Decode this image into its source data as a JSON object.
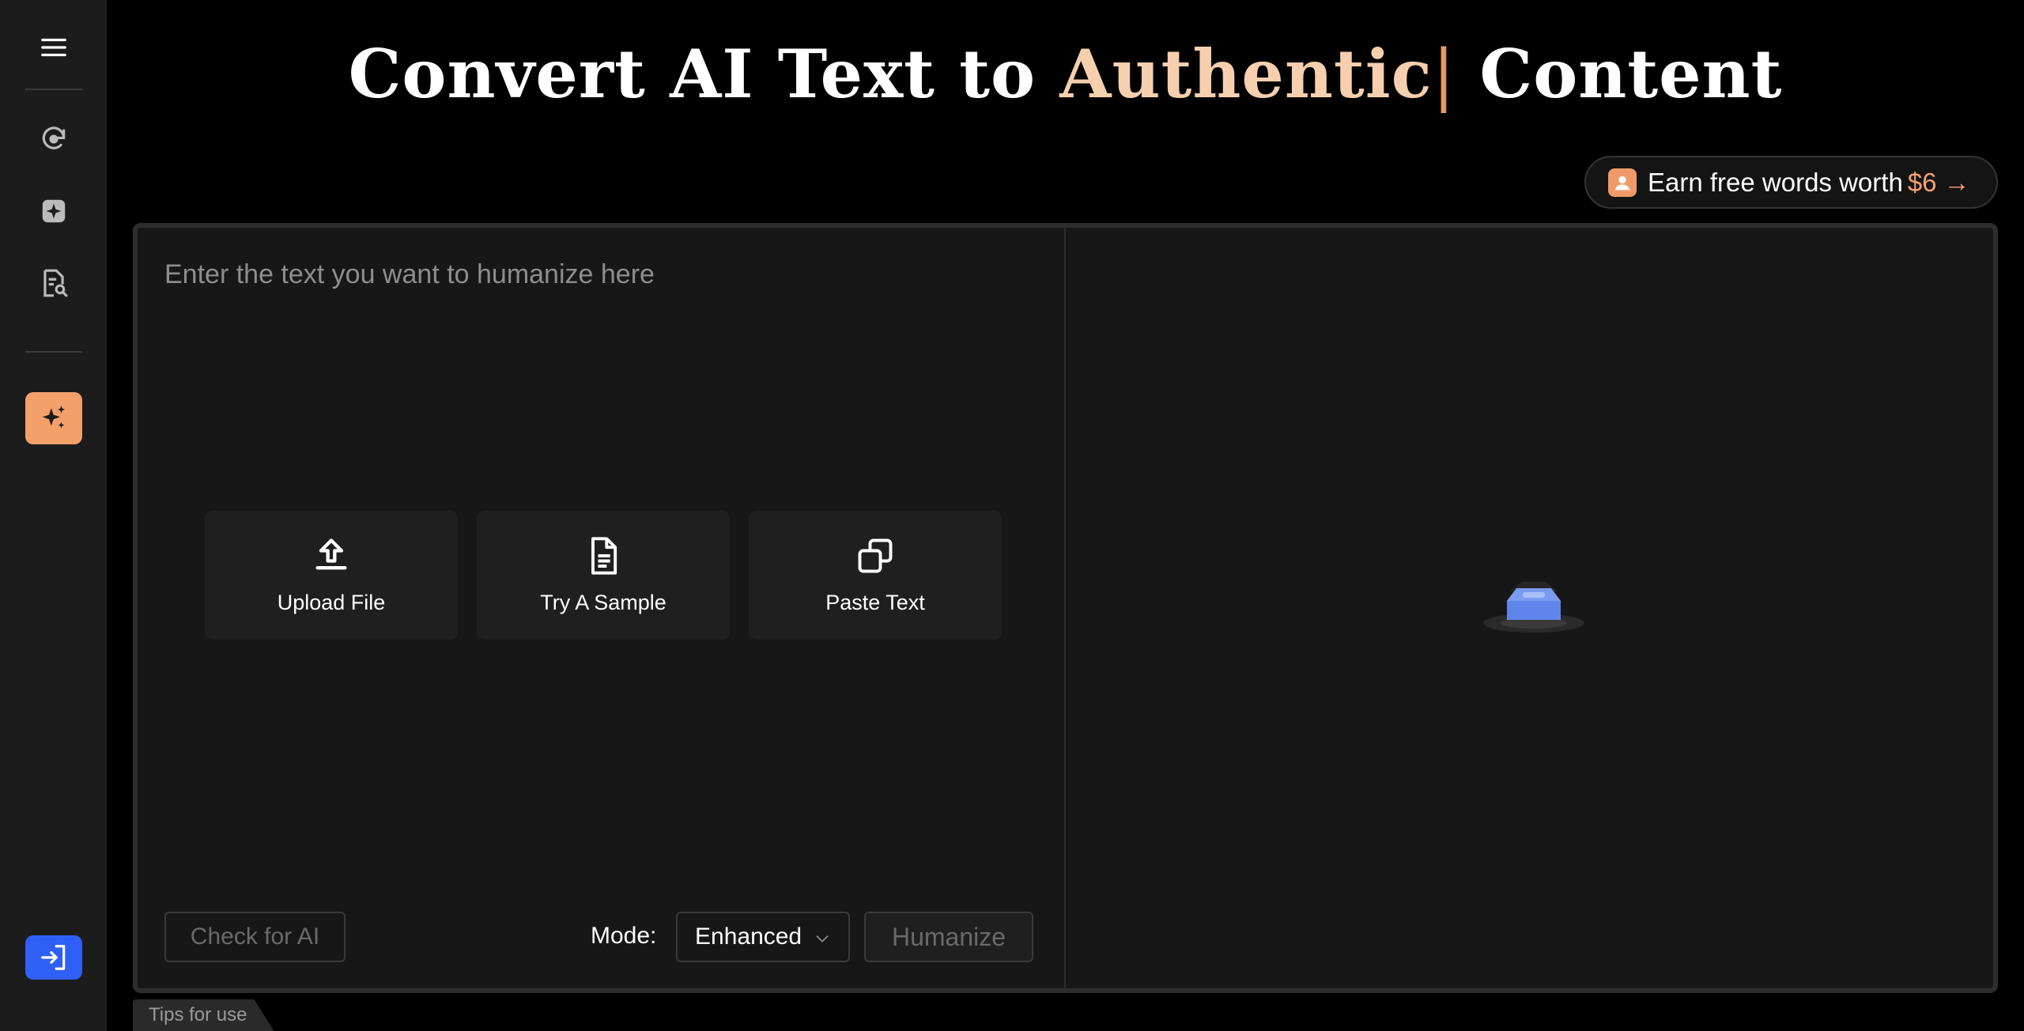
{
  "header": {
    "title_part1": "Convert AI Text to",
    "title_accent": "Authentic",
    "title_cursor": "|",
    "title_part2": "Content"
  },
  "promo": {
    "text": "Earn free words worth",
    "amount": "$6 →"
  },
  "editor": {
    "placeholder": "Enter the text you want to humanize here",
    "actions": [
      {
        "label": "Upload File",
        "icon": "upload-icon"
      },
      {
        "label": "Try A Sample",
        "icon": "document-icon"
      },
      {
        "label": "Paste Text",
        "icon": "copy-icon"
      }
    ],
    "check_ai_label": "Check for AI",
    "mode_label": "Mode:",
    "mode_value": "Enhanced",
    "humanize_label": "Humanize"
  },
  "sidebar": {
    "items": [
      "menu-icon",
      "refresh-ai-icon",
      "sparkle-box-icon",
      "document-search-icon",
      "sparkles-icon",
      "login-icon"
    ]
  },
  "footer": {
    "tips_label": "Tips for use"
  },
  "colors": {
    "accent": "#f6cfae",
    "active_sidebar": "#f4a06b",
    "login_button": "#2f5ff5"
  }
}
